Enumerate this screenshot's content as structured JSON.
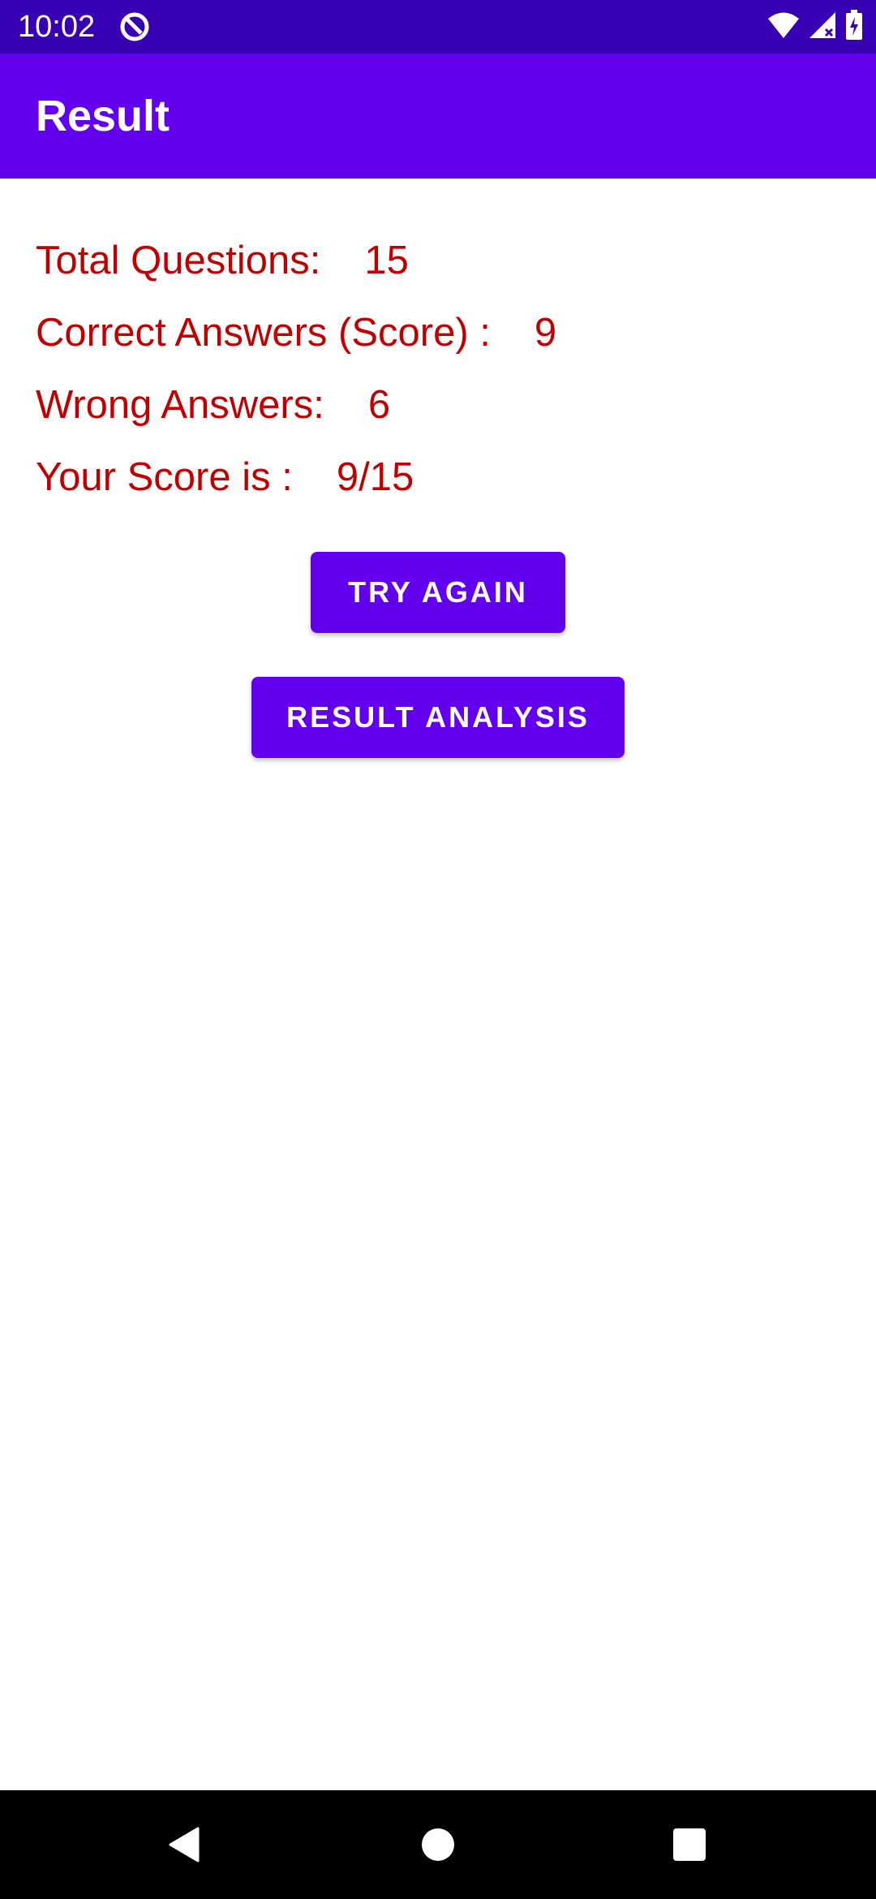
{
  "status_bar": {
    "time": "10:02",
    "icons": [
      "app-notification-icon",
      "wifi-icon",
      "signal-icon",
      "battery-charging-icon"
    ]
  },
  "app_bar": {
    "title": "Result"
  },
  "results": {
    "total_questions_label": "Total Questions:",
    "total_questions_value": "15",
    "correct_answers_label": "Correct Answers (Score) :",
    "correct_answers_value": "9",
    "wrong_answers_label": "Wrong Answers:",
    "wrong_answers_value": "6",
    "score_label": "Your Score is :",
    "score_value": "9/15"
  },
  "buttons": {
    "try_again": "TRY AGAIN",
    "result_analysis": "RESULT ANALYSIS"
  },
  "nav_bar": {
    "icons": [
      "back-icon",
      "home-icon",
      "recents-icon"
    ]
  },
  "colors": {
    "status_bar": "#3700b3",
    "primary": "#6200ee",
    "result_text": "#c00000",
    "nav_bar": "#000000"
  }
}
